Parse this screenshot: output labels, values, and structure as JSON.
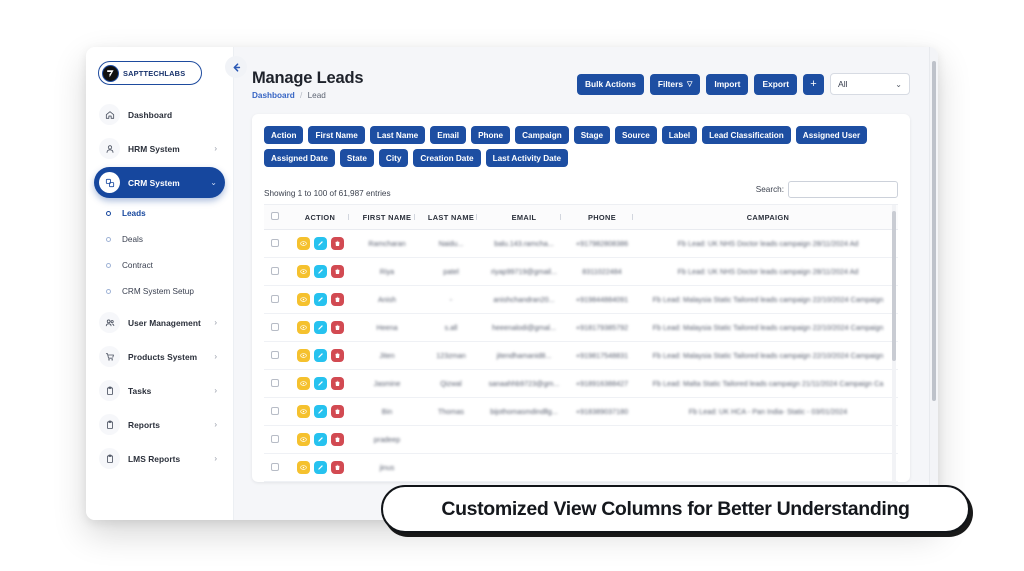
{
  "sidebar": {
    "logo": {
      "text": "SAPTTECHLABS",
      "icon": "logo-mark-icon"
    },
    "collapse_icon": "arrow-left-icon",
    "items": [
      {
        "label": "Dashboard",
        "icon": "home-icon",
        "caret": "",
        "active": false
      },
      {
        "label": "HRM System",
        "icon": "user-icon",
        "caret": "›",
        "active": false
      },
      {
        "label": "CRM System",
        "icon": "apps-icon",
        "caret": "⌄",
        "active": true
      },
      {
        "label": "User Management",
        "icon": "users-icon",
        "caret": "›",
        "active": false
      },
      {
        "label": "Products System",
        "icon": "cart-icon",
        "caret": "›",
        "active": false
      },
      {
        "label": "Tasks",
        "icon": "clipboard-icon",
        "caret": "›",
        "active": false
      },
      {
        "label": "Reports",
        "icon": "clipboard-icon",
        "caret": "›",
        "active": false
      },
      {
        "label": "LMS Reports",
        "icon": "clipboard-icon",
        "caret": "›",
        "active": false
      }
    ],
    "sub_items": [
      {
        "label": "Leads",
        "active": true
      },
      {
        "label": "Deals",
        "active": false
      },
      {
        "label": "Contract",
        "active": false
      },
      {
        "label": "CRM System Setup",
        "active": false
      }
    ]
  },
  "header": {
    "title": "Manage Leads",
    "breadcrumb": {
      "root": "Dashboard",
      "separator": "/",
      "current": "Lead"
    },
    "actions": [
      {
        "label": "Bulk Actions",
        "name": "bulk-actions-button"
      },
      {
        "label": "Filters",
        "name": "filters-button",
        "caret": "▽"
      },
      {
        "label": "Import",
        "name": "import-button"
      },
      {
        "label": "Export",
        "name": "export-button"
      },
      {
        "label": "+",
        "name": "add-button"
      }
    ],
    "view_select": {
      "value": "All",
      "caret": "⌄"
    }
  },
  "columns_chips": [
    "Action",
    "First Name",
    "Last Name",
    "Email",
    "Phone",
    "Campaign",
    "Stage",
    "Source",
    "Label",
    "Lead Classification",
    "Assigned User",
    "Assigned Date",
    "State",
    "City",
    "Creation Date",
    "Last Activity Date"
  ],
  "table": {
    "showing": "Showing 1 to 100 of 61,987 entries",
    "search_label": "Search:",
    "search_value": "",
    "search_placeholder": "",
    "headers": [
      "",
      "ACTION",
      "FIRST NAME",
      "LAST NAME",
      "EMAIL",
      "PHONE",
      "CAMPAIGN"
    ],
    "row_actions": [
      {
        "name": "view-row-button",
        "icon": "eye-icon",
        "color": "#f5c12e"
      },
      {
        "name": "edit-row-button",
        "icon": "pencil-icon",
        "color": "#26c2ef"
      },
      {
        "name": "delete-row-button",
        "icon": "trash-icon",
        "color": "#d24a52"
      }
    ],
    "rows": [
      {
        "first_name": "Ramcharan",
        "last_name": "Naidu...",
        "email": "balu.143.ramcha...",
        "phone": "+917982808386",
        "campaign": "Fb Lead: UK NHS Doctor leads campaign 28/11/2024 Ad"
      },
      {
        "first_name": "Riya",
        "last_name": "patel",
        "email": "riyap99719@gmail...",
        "phone": "8311022484",
        "campaign": "Fb Lead: UK NHS Doctor leads campaign 28/11/2024 Ad"
      },
      {
        "first_name": "Anish",
        "last_name": "-",
        "email": "anishchandran20...",
        "phone": "+919844884091",
        "campaign": "Fb Lead: Malaysia Static Tailored leads campaign 22/10/2024 Campaign"
      },
      {
        "first_name": "Heena",
        "last_name": "s.all",
        "email": "heeenalodi@gmal...",
        "phone": "+918179385792",
        "campaign": "Fb Lead: Malaysia Static Tailored leads campaign 22/10/2024 Campaign"
      },
      {
        "first_name": "Jiten",
        "last_name": "123zman",
        "email": "jitendhamanid8...",
        "phone": "+919817548831",
        "campaign": "Fb Lead: Malaysia Static Tailored leads campaign 22/10/2024 Campaign"
      },
      {
        "first_name": "Jasmine",
        "last_name": "Qizwal",
        "email": "sanaahhb9723@gm...",
        "phone": "+918916388427",
        "campaign": "Fb Lead: Malta Static Tailored leads campaign 21/11/2024 Campaign Ca"
      },
      {
        "first_name": "Bin",
        "last_name": "Thomas",
        "email": "bijothomasmdindllg...",
        "phone": "+918389037180",
        "campaign": "Fb Lead: UK HCA - Pan India- Static - 03/01/2024"
      },
      {
        "first_name": "pradeep",
        "last_name": "",
        "email": "",
        "phone": "",
        "campaign": ""
      },
      {
        "first_name": "jinus",
        "last_name": "",
        "email": "",
        "phone": "",
        "campaign": ""
      }
    ]
  },
  "caption": {
    "text": "Customized View Columns for Better Understanding"
  }
}
